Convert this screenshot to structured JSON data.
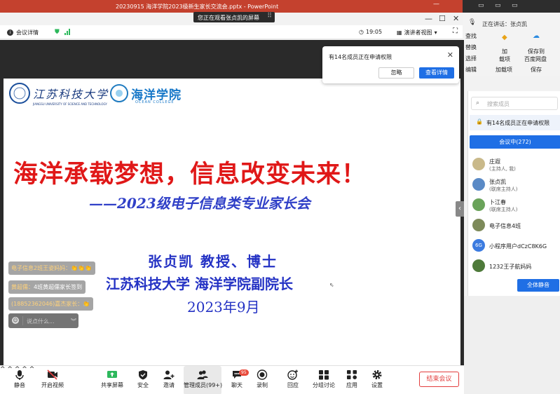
{
  "ppt": {
    "title": "20230915 海洋学院2023级新生家长交流会.pptx  -  PowerPoint",
    "minimize": "—",
    "ribbon": {
      "find": "查找",
      "replace": "替换",
      "select": "选择",
      "editing": "编辑",
      "add_item": "加",
      "add_item_2": "载项",
      "addins_group": "加载项",
      "save_to": "保存到",
      "baidu": "百度网盘",
      "save_group": "保存"
    }
  },
  "share_banner": {
    "text": "您正在观看张贞凯的屏幕",
    "grip": "⠿"
  },
  "window_controls": {
    "minimize": "—",
    "maximize": "☐",
    "close": "✕"
  },
  "top_bar": {
    "meeting_info": "会议详情",
    "time": "19:05",
    "view_mode": "演讲者视图",
    "info_icon": "i",
    "fullscreen_icon": "⛶"
  },
  "slide": {
    "jiangsu_name": "江苏科技大学",
    "jiangsu_sub": "JIANGSU UNIVERSITY OF SCIENCE AND TECHNOLOGY",
    "ocean_name": "海洋学院",
    "ocean_sub": "OCEAN COLLEGE",
    "title": "海洋承载梦想，信息改变未来！",
    "subtitle": "——2023级电子信息类专业家长会",
    "presenter": "张贞凯   教授、博士",
    "affiliation": "江苏科技大学 海洋学院副院长",
    "date": "2023年9月",
    "cursor": "⇖"
  },
  "chat_overlay": {
    "messages": [
      {
        "who": "电子信息2班王姿妈妈：",
        "text": "👏👏👏"
      },
      {
        "who": "黄超儒：",
        "text": "4班黄超儒家长签到"
      },
      {
        "who": "(18852362046)嘉杰家长：",
        "text": "👏"
      }
    ],
    "input_placeholder": "说点什么...",
    "emoji_icon": "☺",
    "chevron": "︾"
  },
  "collapse_arrow": "‹",
  "notice": {
    "message": "有14名成员正在申请权限",
    "close": "✕",
    "ignore": "忽略",
    "details": "查看详情"
  },
  "toolbar": {
    "mute": "静音",
    "video": "开启视频",
    "share": "共享屏幕",
    "security": "安全",
    "invite": "邀请",
    "manage": "管理成员(99+)",
    "chat": "聊天",
    "chat_badge": "95",
    "record": "录制",
    "reaction": "回应",
    "breakout": "分组讨论",
    "apps": "应用",
    "settings": "设置",
    "end_meeting": "结束会议",
    "caret": "^"
  },
  "right_panel": {
    "speaking_label": "正在讲话：",
    "speaking_name": "张贞凯",
    "search_placeholder": "搜索成员",
    "permission_notice": "有14名成员正在申请权限",
    "in_meeting_tab": "会议中(272)",
    "members": [
      {
        "name": "庄遐",
        "role": "(主持人, 我)",
        "avatar": ""
      },
      {
        "name": "张贞凯",
        "role": "(联席主持人)",
        "avatar": ""
      },
      {
        "name": "卜江春",
        "role": "(联席主持人)",
        "avatar": ""
      },
      {
        "name": "电子信息4班",
        "role": "",
        "avatar": ""
      },
      {
        "name": "小程序用户dCzC8K6G",
        "role": "",
        "avatar": "6G"
      },
      {
        "name": "1232王子航妈妈",
        "role": "",
        "avatar": ""
      }
    ],
    "mute_all": "全体静音"
  },
  "colors": {
    "accent_blue": "#1f6fe5",
    "ppt_red": "#c4412e",
    "end_red": "#e23d3d",
    "slide_red": "#e01818",
    "slide_blue": "#2432c4"
  }
}
